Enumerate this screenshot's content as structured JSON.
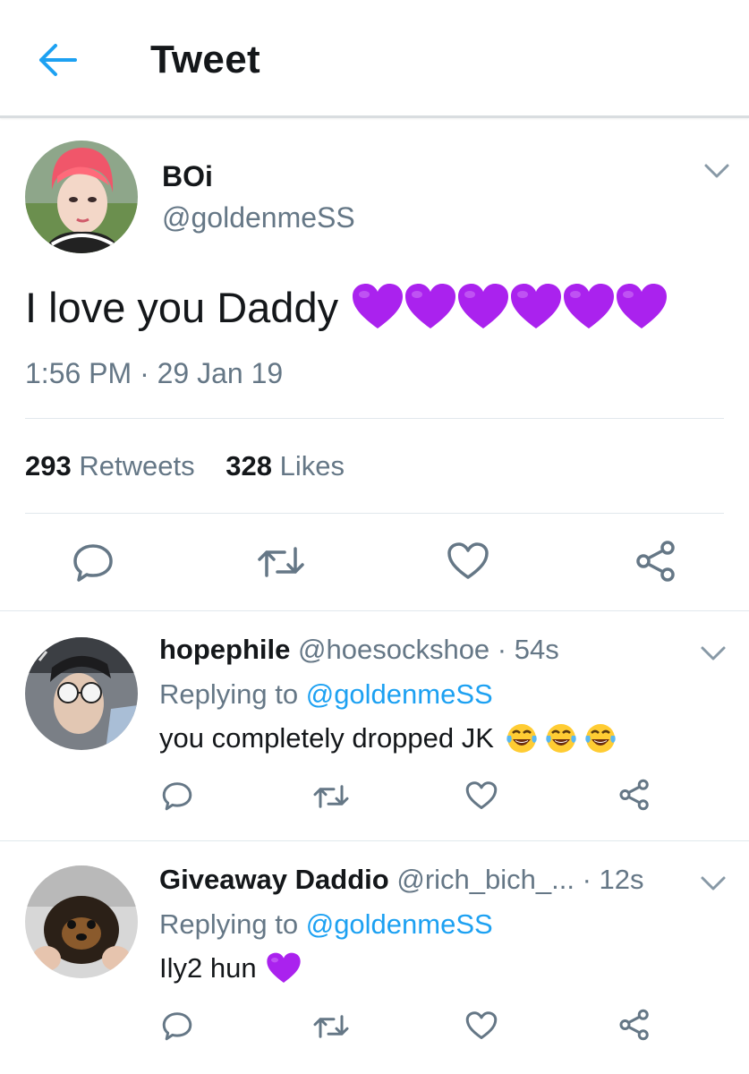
{
  "header": {
    "title": "Tweet",
    "back_icon": "arrow-left-icon",
    "accent": "#1da1f2"
  },
  "main_tweet": {
    "name": "BOi",
    "handle": "@goldenmeSS",
    "text": "I love you Daddy",
    "emoji": "purple-heart",
    "emoji_count": 6,
    "time": "1:56 PM · 29 Jan 19",
    "retweets": {
      "count": "293",
      "label": "Retweets"
    },
    "likes": {
      "count": "328",
      "label": "Likes"
    },
    "actions": [
      "reply-icon",
      "retweet-icon",
      "like-icon",
      "share-icon"
    ]
  },
  "replies": [
    {
      "name": "hopephile",
      "handle": "@hoesockshoe",
      "time": "· 54s",
      "replying_label": "Replying to",
      "replying_to": "@goldenmeSS",
      "text": "you completely dropped JK",
      "emoji": "face-with-tears-of-joy",
      "emoji_count": 3
    },
    {
      "name": "Giveaway Daddio",
      "handle": "@rich_bich_...",
      "time": "· 12s",
      "replying_label": "Replying to",
      "replying_to": "@goldenmeSS",
      "text": "Ily2 hun",
      "emoji": "purple-heart",
      "emoji_count": 1
    }
  ],
  "colors": {
    "text": "#14171a",
    "secondary": "#657786",
    "link": "#1da1f2",
    "heart": "#aa22ee",
    "divider": "#e1e8ed"
  }
}
